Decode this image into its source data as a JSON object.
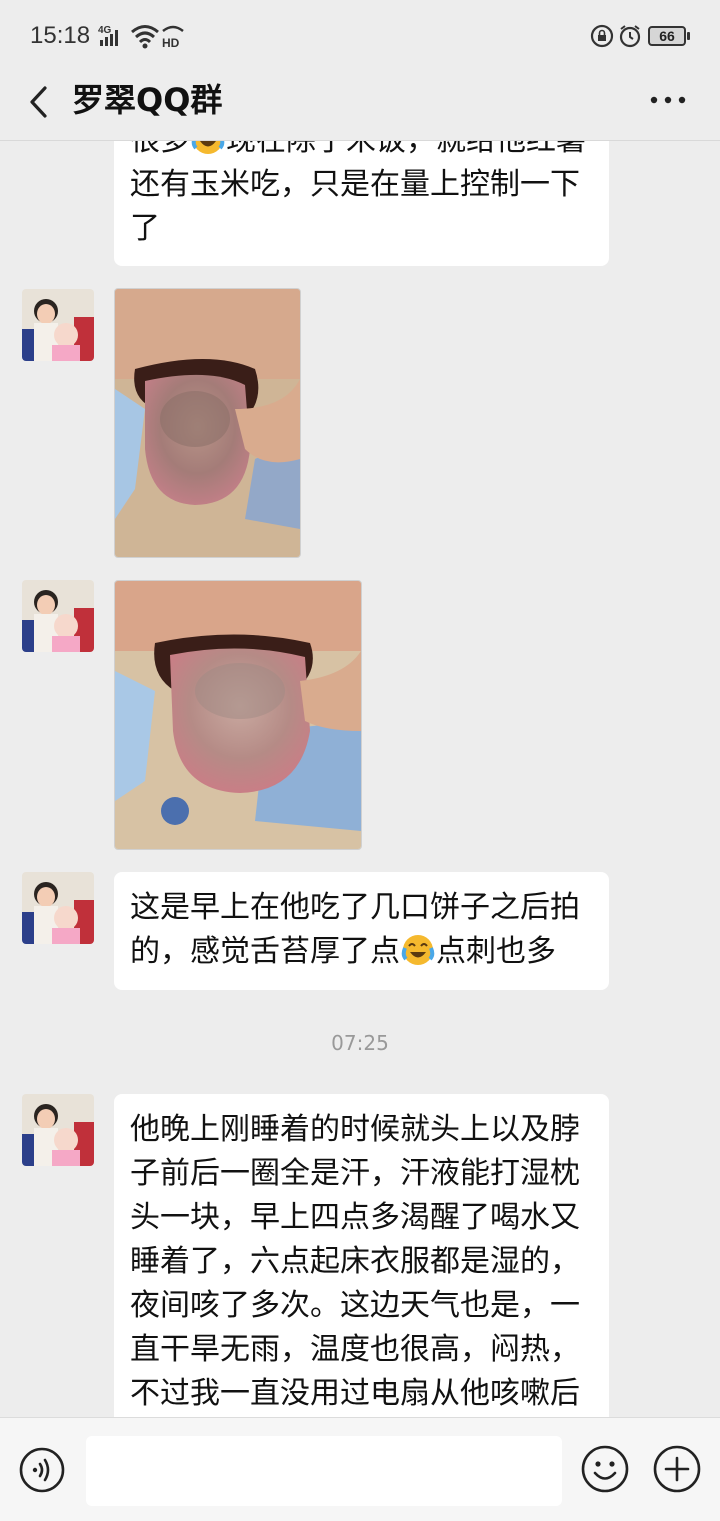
{
  "status_bar": {
    "time": "15:18",
    "battery": "66"
  },
  "header": {
    "title": "罗翠QQ群"
  },
  "messages": {
    "m1_text_a": "很多",
    "m1_text_b": "现在除了米饭，就给他红薯还有玉米吃，只是在量上控制一下了",
    "m4_text_a": "这是早上在他吃了几口饼子之后拍的，感觉舌苔厚了点",
    "m4_text_b": "点刺也多",
    "timestamp": "07:25",
    "m5_text": "他晚上刚睡着的时候就头上以及脖子前后一圈全是汗，汗液能打湿枕头一块，早上四点多渴醒了喝水又睡着了，六点起床衣服都是湿的，夜间咳了多次。这边天气也是，一直干旱无雨，温度也很高，闷热，不过我一直没用过电扇从他咳嗽后"
  },
  "input": {
    "value": ""
  },
  "colors": {
    "background": "#ededed",
    "bubble": "#ffffff",
    "timestamp": "#999999"
  }
}
